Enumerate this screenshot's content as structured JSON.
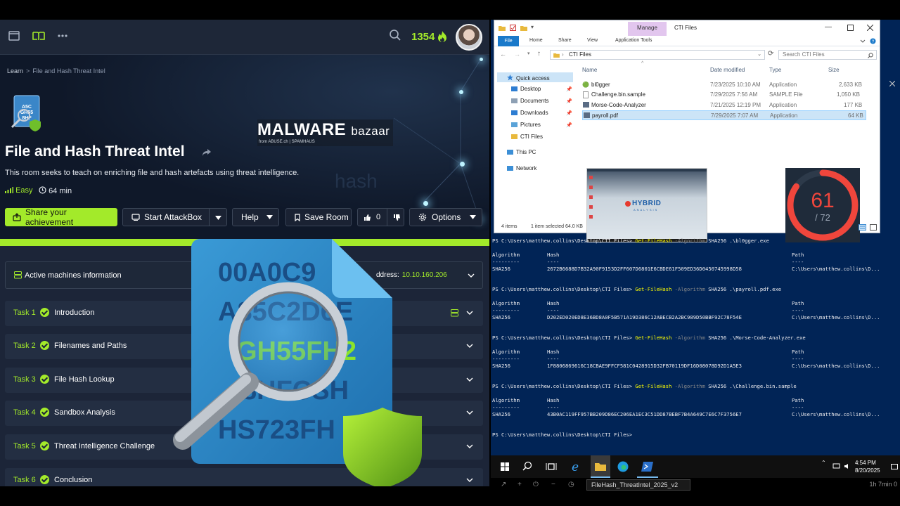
{
  "thm": {
    "points": "1354",
    "breadcrumb": {
      "root": "Learn",
      "sep": ">",
      "current": "File and Hash Threat Intel"
    },
    "malware_bazaar": {
      "title": "MALWARE",
      "title2": "bazaar",
      "sub": "from ABUSE.ch | SPAMHAUS"
    },
    "room_title": "File and Hash Threat Intel",
    "room_desc": "This room seeks to teach on enriching file and hash artefacts using threat intelligence.",
    "ghost_word": "hash",
    "difficulty": "Easy",
    "duration": "64 min",
    "buttons": {
      "share": "Share your achievement",
      "attackbox": "Start AttackBox",
      "help": "Help",
      "save": "Save Room",
      "likes": "0",
      "options": "Options"
    },
    "active_machines": "Active machines information",
    "ip_label": "ddress:",
    "ip_value": "10.10.160.206",
    "tasks": [
      {
        "num": "Task 1",
        "title": "Introduction"
      },
      {
        "num": "Task 2",
        "title": "Filenames and Paths"
      },
      {
        "num": "Task 3",
        "title": "File Hash Lookup"
      },
      {
        "num": "Task 4",
        "title": "Sandbox Analysis"
      },
      {
        "num": "Task 5",
        "title": "Threat Intelligence Challenge"
      },
      {
        "num": "Task 6",
        "title": "Conclusion"
      }
    ],
    "overlay_hash_lines": [
      "00A0C9",
      "A85C2D6E",
      "GH55FH2",
      "8HFCSH",
      "HS723FH"
    ]
  },
  "explorer": {
    "manage": "Manage",
    "window_title": "CTI Files",
    "ribbon": {
      "file": "File",
      "home": "Home",
      "share": "Share",
      "view": "View",
      "app_tools": "Application Tools"
    },
    "address": "CTI Files",
    "search_placeholder": "Search CTI Files",
    "nav": [
      "Quick access",
      "Desktop",
      "Documents",
      "Downloads",
      "Pictures",
      "CTI Files",
      "This PC",
      "Network"
    ],
    "columns": {
      "name": "Name",
      "date": "Date modified",
      "type": "Type",
      "size": "Size"
    },
    "files": [
      {
        "name": "bl0gger",
        "date": "7/23/2025 10:10 AM",
        "type": "Application",
        "size": "2,633 KB"
      },
      {
        "name": "Challenge.bin.sample",
        "date": "7/29/2025 7:56 AM",
        "type": "SAMPLE File",
        "size": "1,050 KB"
      },
      {
        "name": "Morse-Code-Analyzer",
        "date": "7/21/2025 12:19 PM",
        "type": "Application",
        "size": "177 KB"
      },
      {
        "name": "payroll.pdf",
        "date": "7/29/2025 7:07 AM",
        "type": "Application",
        "size": "64 KB"
      }
    ],
    "hybrid_logo": {
      "line1": "HYBRID",
      "line2": "ANALYSIS"
    },
    "vt_score": {
      "value": "61",
      "total": "/ 72",
      "fraction": 0.847
    },
    "status": {
      "count": "4 items",
      "selected": "1 item selected  64.0 KB"
    }
  },
  "powershell": {
    "prompt": "PS C:\\Users\\matthew.collins\\Desktop\\CTI Files>",
    "cmdlet": "Get-FileHash",
    "param": "-Algorithm",
    "header": {
      "algorithm": "Algorithm",
      "hash": "Hash",
      "path": "Path",
      "dash_a": "---------",
      "dash_h": "----",
      "dash_p": "----"
    },
    "entries": [
      {
        "arg": "SHA256 .\\bl0gger.exe",
        "algo": "SHA256",
        "hash": "2672B6688D7B32A90F9153D2FF607D6801E6CBDE61F509ED36D0450745998D58",
        "path": "C:\\Users\\matthew.collins\\D..."
      },
      {
        "arg": "SHA256 .\\payroll.pdf.exe",
        "algo": "SHA256",
        "hash": "D202ED020ED8E36BD8A0F5B571A19D386C12ABECB2A2BC989D50BBF92C78F54E",
        "path": "C:\\Users\\matthew.collins\\D..."
      },
      {
        "arg": "SHA256 .\\Morse-Code-Analyzer.exe",
        "algo": "SHA256",
        "hash": "1F8806869616C18CBAE9FFCF581C0428915D32FB70119DF16D08078D92D1A5E3",
        "path": "C:\\Users\\matthew.collins\\D..."
      },
      {
        "arg": "SHA256 .\\Challenge.bin.sample",
        "algo": "SHA256",
        "hash": "43B0AC119FF957BB209D86EC206EA1EC3C51DD87BEBF7B4A649C7E6C7F3756E7",
        "path": "C:\\Users\\matthew.collins\\D..."
      }
    ]
  },
  "taskbar": {
    "time": "4:54 PM",
    "date": "8/20/2025"
  },
  "video": {
    "tab_title": "FileHash_ThreatIntel_2025_v2",
    "elapsed": "1h 7min 0"
  }
}
